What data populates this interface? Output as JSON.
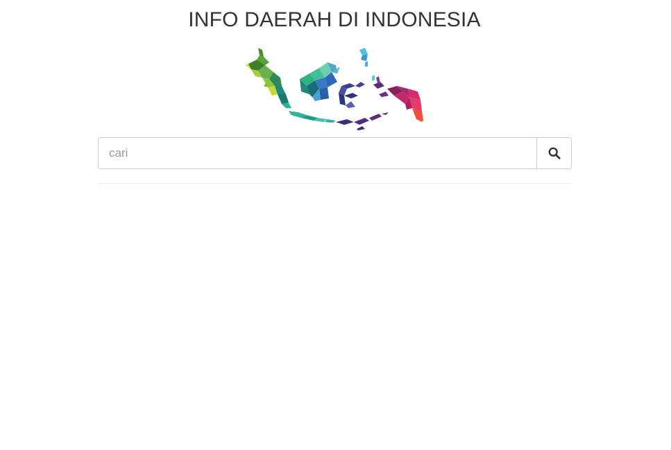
{
  "header": {
    "title": "INFO DAERAH DI INDONESIA"
  },
  "logo": {
    "icon": "indonesia-map-logo",
    "colors": [
      "#5aa13a",
      "#a8cf3a",
      "#1d8a7a",
      "#2fb39a",
      "#3a78c4",
      "#4fc0e0",
      "#3b3f8f",
      "#5a2f7a",
      "#8a1f5e",
      "#d92a6e",
      "#f0503a"
    ]
  },
  "search": {
    "placeholder": "cari",
    "value": "",
    "button_icon": "search-icon"
  }
}
